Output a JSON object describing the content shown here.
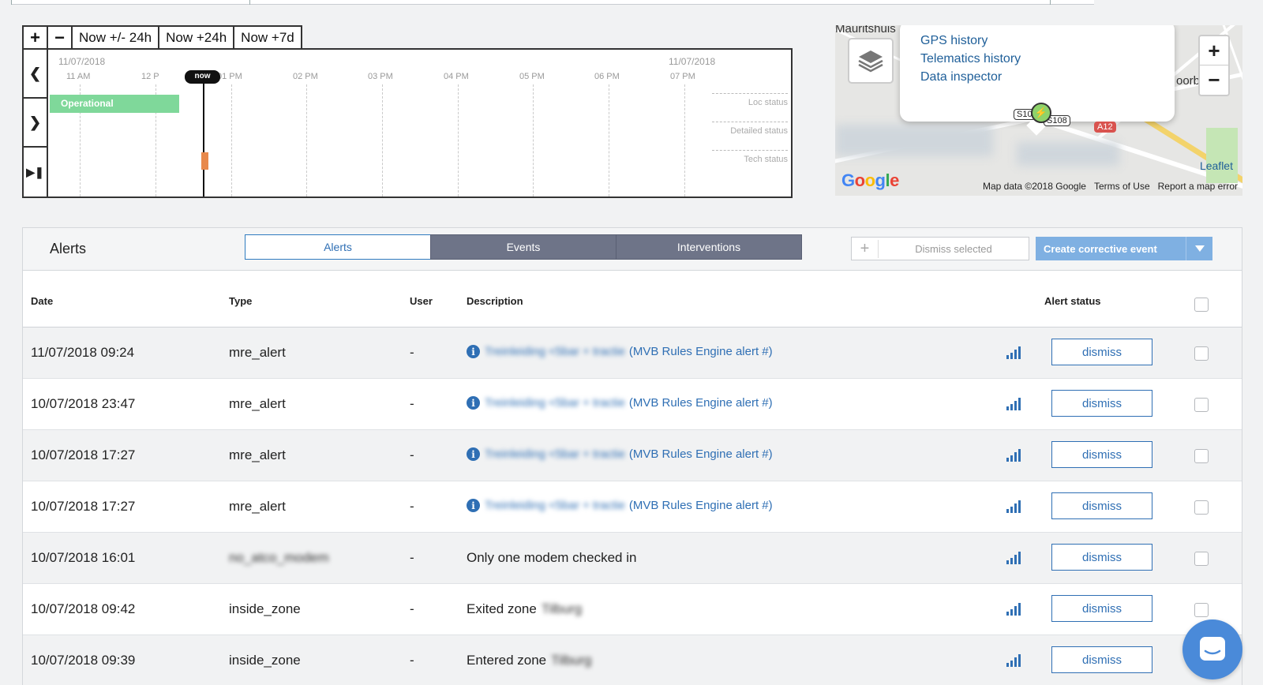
{
  "timeline": {
    "zoom_in": "+",
    "zoom_out": "−",
    "range_buttons": [
      "Now +/- 24h",
      "Now +24h",
      "Now +7d"
    ],
    "date_left": "11/07/2018",
    "date_right": "11/07/2018",
    "hours": [
      "11 AM",
      "12 P",
      "01 PM",
      "02 PM",
      "03 PM",
      "04 PM",
      "05 PM",
      "06 PM",
      "07 PM"
    ],
    "now_label": "now",
    "operational_label": "Operational",
    "row_labels": [
      "Loc status",
      "Detailed status",
      "Tech status"
    ]
  },
  "map": {
    "place_label": "Mauritshuis",
    "place_label_right": "oorb",
    "menu_items": [
      "GPS history",
      "Telematics history",
      "Data inspector"
    ],
    "zoom_in": "+",
    "zoom_out": "−",
    "google_logo": "Google",
    "leaflet": "Leaflet",
    "attribution": [
      "Map data ©2018 Google",
      "Terms of Use",
      "Report a map error"
    ],
    "shields": [
      "S10",
      "S108",
      "A12"
    ]
  },
  "alerts": {
    "title": "Alerts",
    "tabs": [
      "Alerts",
      "Events",
      "Interventions"
    ],
    "active_tab": "Alerts",
    "dismiss_selected": "Dismiss selected",
    "create_corrective": "Create corrective event",
    "columns": {
      "date": "Date",
      "type": "Type",
      "user": "User",
      "description": "Description",
      "status": "Alert status"
    },
    "dismiss_label": "dismiss",
    "rows": [
      {
        "date": "11/07/2018 09:24",
        "type": "mre_alert",
        "user": "-",
        "blur": "Treinleiding <5bar + tractie",
        "desc": "(MVB Rules Engine alert #)",
        "kind": "link"
      },
      {
        "date": "10/07/2018 23:47",
        "type": "mre_alert",
        "user": "-",
        "blur": "Treinleiding <5bar + tractie",
        "desc": "(MVB Rules Engine alert #)",
        "kind": "link"
      },
      {
        "date": "10/07/2018 17:27",
        "type": "mre_alert",
        "user": "-",
        "blur": "Treinleiding <5bar + tractie",
        "desc": "(MVB Rules Engine alert #)",
        "kind": "link"
      },
      {
        "date": "10/07/2018 17:27",
        "type": "mre_alert",
        "user": "-",
        "blur": "Treinleiding <5bar + tractie",
        "desc": "(MVB Rules Engine alert #)",
        "kind": "link"
      },
      {
        "date": "10/07/2018 16:01",
        "type": "no_atco_modem",
        "user": "-",
        "blur": "",
        "desc": "Only one modem checked in",
        "kind": "plain",
        "type_blurred": true
      },
      {
        "date": "10/07/2018 09:42",
        "type": "inside_zone",
        "user": "-",
        "blur": "Tilburg",
        "desc": "Exited zone",
        "kind": "zone"
      },
      {
        "date": "10/07/2018 09:39",
        "type": "inside_zone",
        "user": "-",
        "blur": "Tilburg",
        "desc": "Entered zone",
        "kind": "zone"
      }
    ]
  },
  "colors": {
    "accent": "#2f6fb4",
    "operational": "#7fd89a",
    "tab_inactive": "#6e7488",
    "corrective": "#7fb0e2"
  }
}
